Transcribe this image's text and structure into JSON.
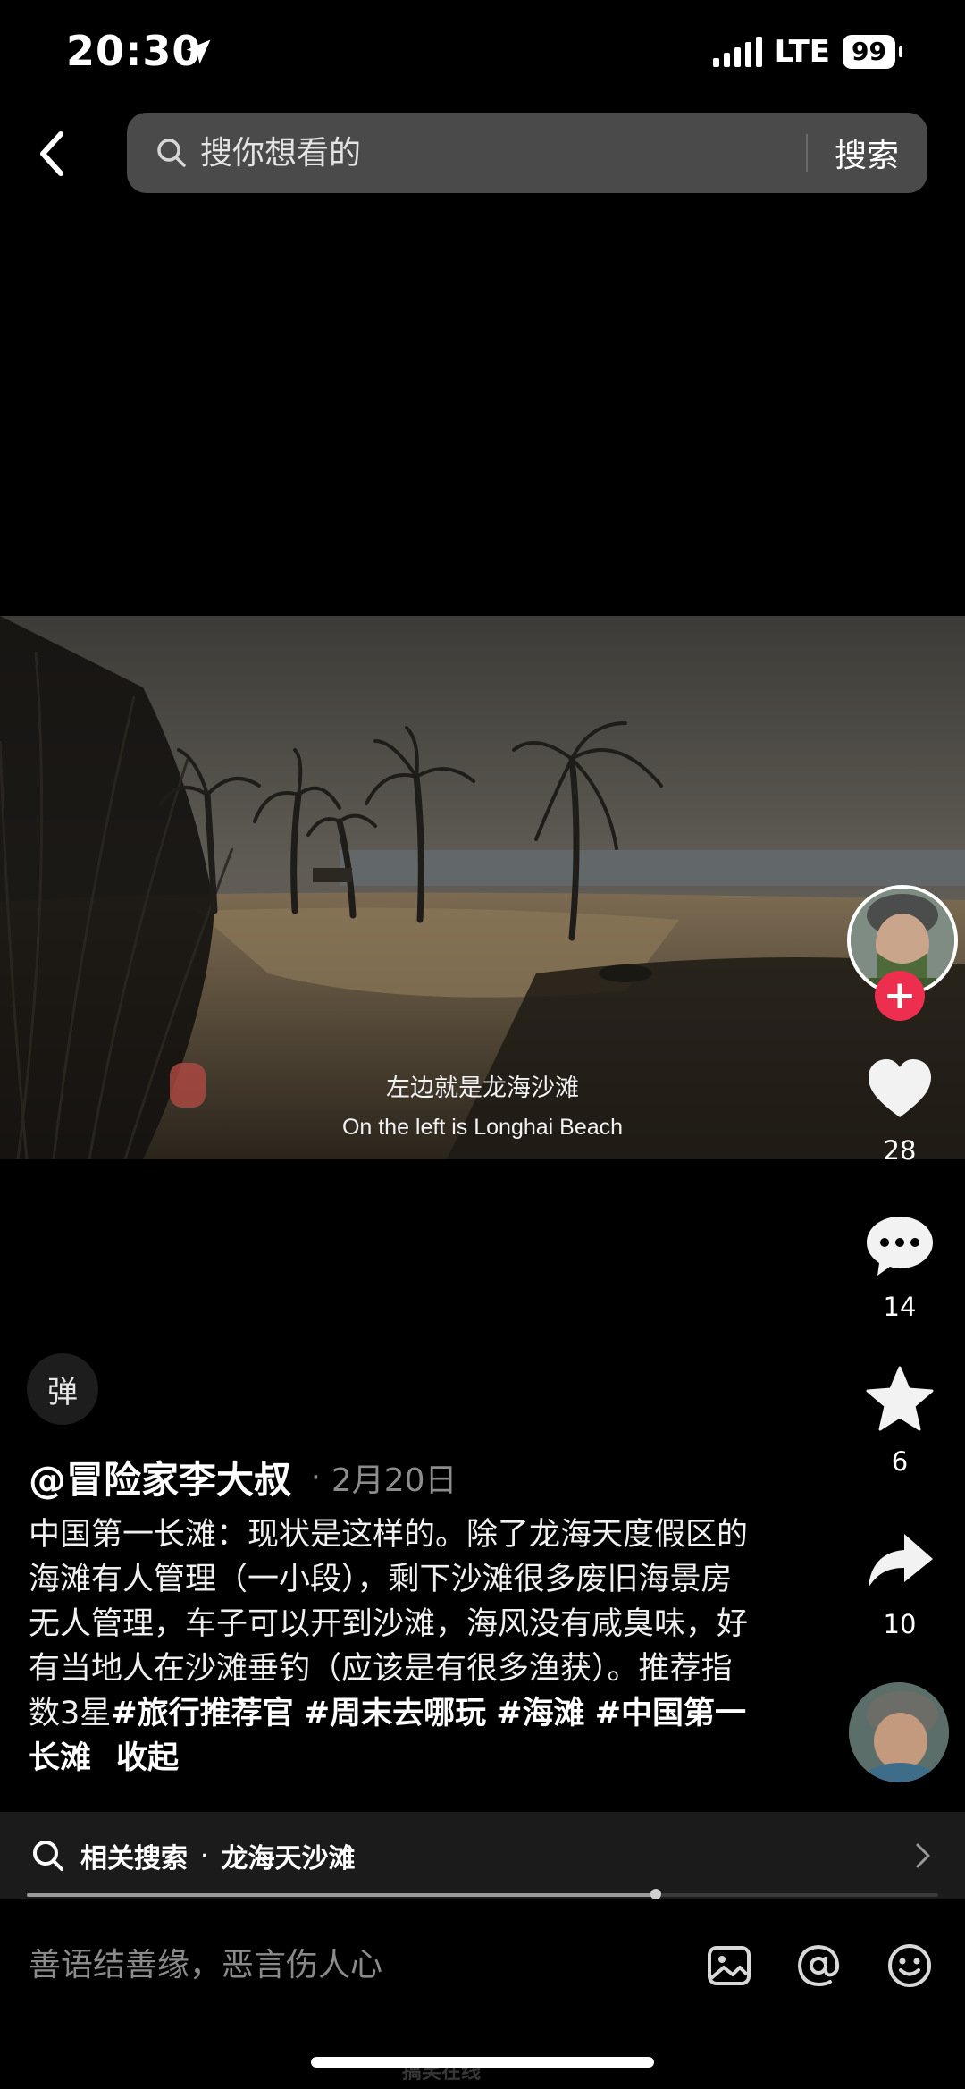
{
  "status_bar": {
    "time": "20:30",
    "network": "LTE",
    "battery": "99"
  },
  "search": {
    "placeholder": "搜你想看的",
    "button_label": "搜索"
  },
  "video": {
    "subtitle_cn": "左边就是龙海沙滩",
    "subtitle_en": "On the left is Longhai Beach"
  },
  "actions": {
    "follow_label": "+",
    "likes": "28",
    "comments": "14",
    "favorites": "6",
    "shares": "10"
  },
  "danmu_label": "弹",
  "post": {
    "author": "@冒险家李大叔",
    "separator": "·",
    "date": "2月20日",
    "caption": "中国第一长滩：现状是这样的。除了龙海天度假区的海滩有人管理（一小段），剩下沙滩很多废旧海景房无人管理，车子可以开到沙滩，海风没有咸臭味，好有当地人在沙滩垂钓（应该是有很多渔获）。推荐指数3星",
    "tags": [
      "#旅行推荐官",
      "#周末去哪玩",
      "#海滩",
      "#中国第一长滩"
    ],
    "collapse_label": "收起"
  },
  "related": {
    "label": "相关搜索",
    "separator": "·",
    "term": "龙海天沙滩"
  },
  "playback": {
    "progress_fraction": 0.69
  },
  "comment_bar": {
    "placeholder": "善语结善缘，恶言伤人心"
  },
  "watermark": "搞笑在线",
  "colors": {
    "accent_red": "#ee2e4f",
    "search_bg": "#4a4a4a",
    "muted_text": "#8c8c8c"
  }
}
